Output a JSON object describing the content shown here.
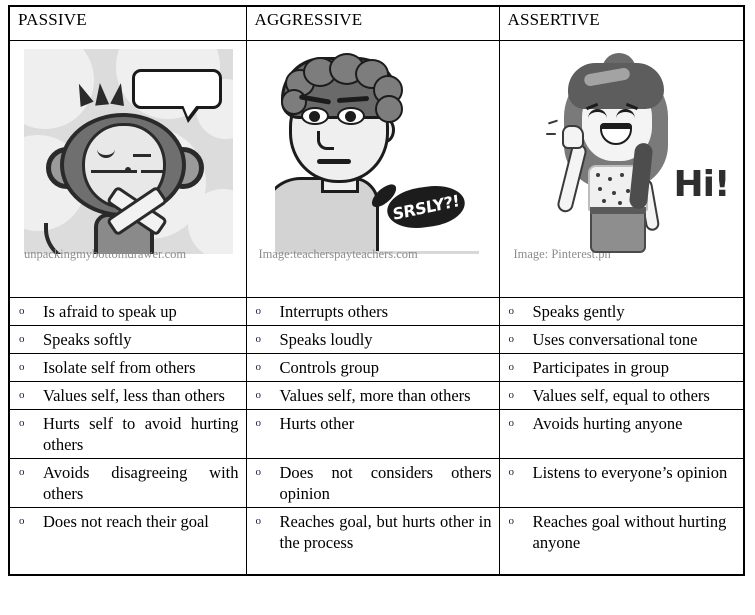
{
  "table": {
    "columns": [
      {
        "header": "PASSIVE"
      },
      {
        "header": "AGGRESSIVE"
      },
      {
        "header": "ASSERTIVE"
      }
    ],
    "images": [
      {
        "alt": "Cartoon monkey with mouth taped shut and an empty speech bubble",
        "caption": "unpackingmybottomdrawer.com",
        "bubble_text": ""
      },
      {
        "alt": "Bitmoji boy with curly hair frowning with a speech bubble",
        "caption": "Image:teacherspayteachers.com",
        "bubble_text": "SRSLY?!"
      },
      {
        "alt": "Smiling cartoon girl waving hello",
        "caption": "Image: Pinterest.ph",
        "bubble_text": "Hi!"
      }
    ],
    "bullet_marker": "o",
    "rows": [
      {
        "passive": "Is afraid to speak up",
        "aggressive": "Interrupts others",
        "assertive": "Speaks gently"
      },
      {
        "passive": "Speaks softly",
        "aggressive": "Speaks loudly",
        "assertive": "Uses conversational tone"
      },
      {
        "passive": "Isolate self from others",
        "aggressive": "Controls group",
        "assertive": "Participates in group"
      },
      {
        "passive": "Values self, less than others",
        "aggressive": "Values self, more than others",
        "assertive": "Values self, equal to others"
      },
      {
        "passive": "Hurts self to avoid hurting others",
        "aggressive": "Hurts other",
        "assertive": "Avoids hurting anyone"
      },
      {
        "passive": "Avoids disagreeing with others",
        "aggressive": "Does not considers others opinion",
        "assertive": "Listens to everyone’s opinion"
      },
      {
        "passive": "Does not reach their goal",
        "aggressive": "Reaches goal, but hurts other in the process",
        "assertive": "Reaches goal without hurting anyone"
      }
    ]
  },
  "colors": {
    "border": "#000000",
    "text": "#000000",
    "caption": "#8d8d8d",
    "bubble_dark": "#1c1c1c"
  }
}
